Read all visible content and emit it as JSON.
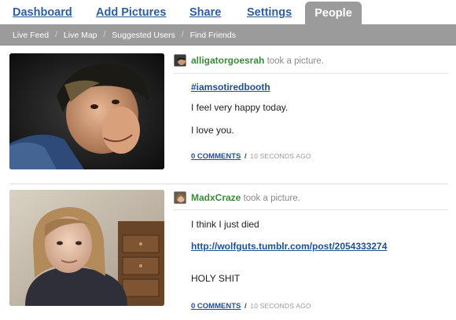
{
  "nav": {
    "tabs": [
      "Dashboard",
      "Add Pictures",
      "Share",
      "Settings"
    ],
    "active_tab": "People"
  },
  "subnav": {
    "items": [
      "Live Feed",
      "Live Map",
      "Suggested Users",
      "Find Friends"
    ],
    "separator": "/"
  },
  "posts": [
    {
      "username": "alligatorgoesrah",
      "action": "took a picture.",
      "hashtag": "#iamsotiredbooth",
      "lines": [
        "I feel very happy today.",
        "I love you."
      ],
      "comments_label": "0 COMMENTS",
      "separator": "/",
      "time_ago": "10 SECONDS AGO"
    },
    {
      "username": "MadxCraze",
      "action": "took a picture.",
      "line1": "I think I just died",
      "link": "http://wolfguts.tumblr.com/post/2054333274",
      "line2": "HOLY SHIT",
      "comments_label": "0 COMMENTS",
      "separator": "/",
      "time_ago": "10 SECONDS AGO"
    }
  ],
  "colors": {
    "tab_link": "#2e5e9c",
    "active_tab_bg": "#9b9b9b",
    "username": "#3a8a3a",
    "link": "#1f4f8e"
  }
}
